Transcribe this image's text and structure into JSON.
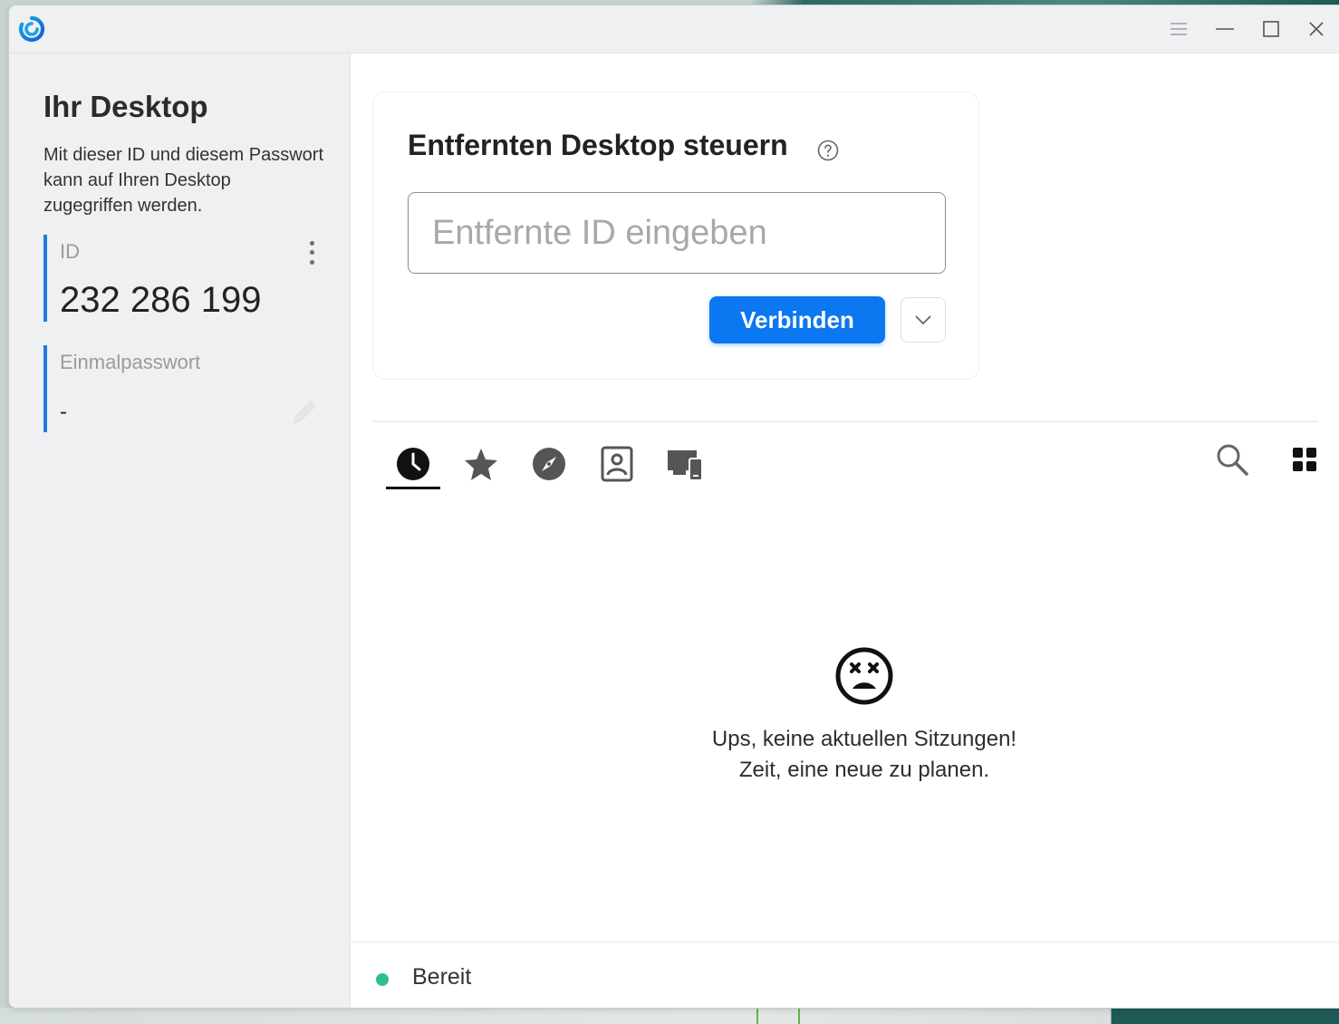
{
  "window": {
    "menu_icon": "hamburger-menu-icon",
    "minimize_icon": "minimize-icon",
    "maximize_icon": "maximize-icon",
    "close_icon": "close-icon"
  },
  "sidebar": {
    "title": "Ihr Desktop",
    "description": "Mit dieser ID und diesem Passwort kann auf Ihren Desktop zugegriffen werden.",
    "id_label": "ID",
    "id_value": "232 286 199",
    "password_label": "Einmalpasswort",
    "password_value": "-"
  },
  "connect": {
    "title": "Entfernten Desktop steuern",
    "input_placeholder": "Entfernte ID eingeben",
    "input_value": "",
    "button_label": "Verbinden"
  },
  "tabs": [
    {
      "icon": "recent-clock-icon",
      "active": true
    },
    {
      "icon": "favorites-star-icon",
      "active": false
    },
    {
      "icon": "discovered-compass-icon",
      "active": false
    },
    {
      "icon": "address-book-icon",
      "active": false
    },
    {
      "icon": "devices-icon",
      "active": false
    }
  ],
  "empty_state": {
    "line1": "Ups, keine aktuellen Sitzungen!",
    "line2": "Zeit, eine neue zu planen."
  },
  "status": {
    "text": "Bereit",
    "color": "#2fbf8f"
  },
  "colors": {
    "accent": "#0b77f0",
    "sidebar_bg": "#eef0f2",
    "id_bar": "#1f7ae0"
  }
}
